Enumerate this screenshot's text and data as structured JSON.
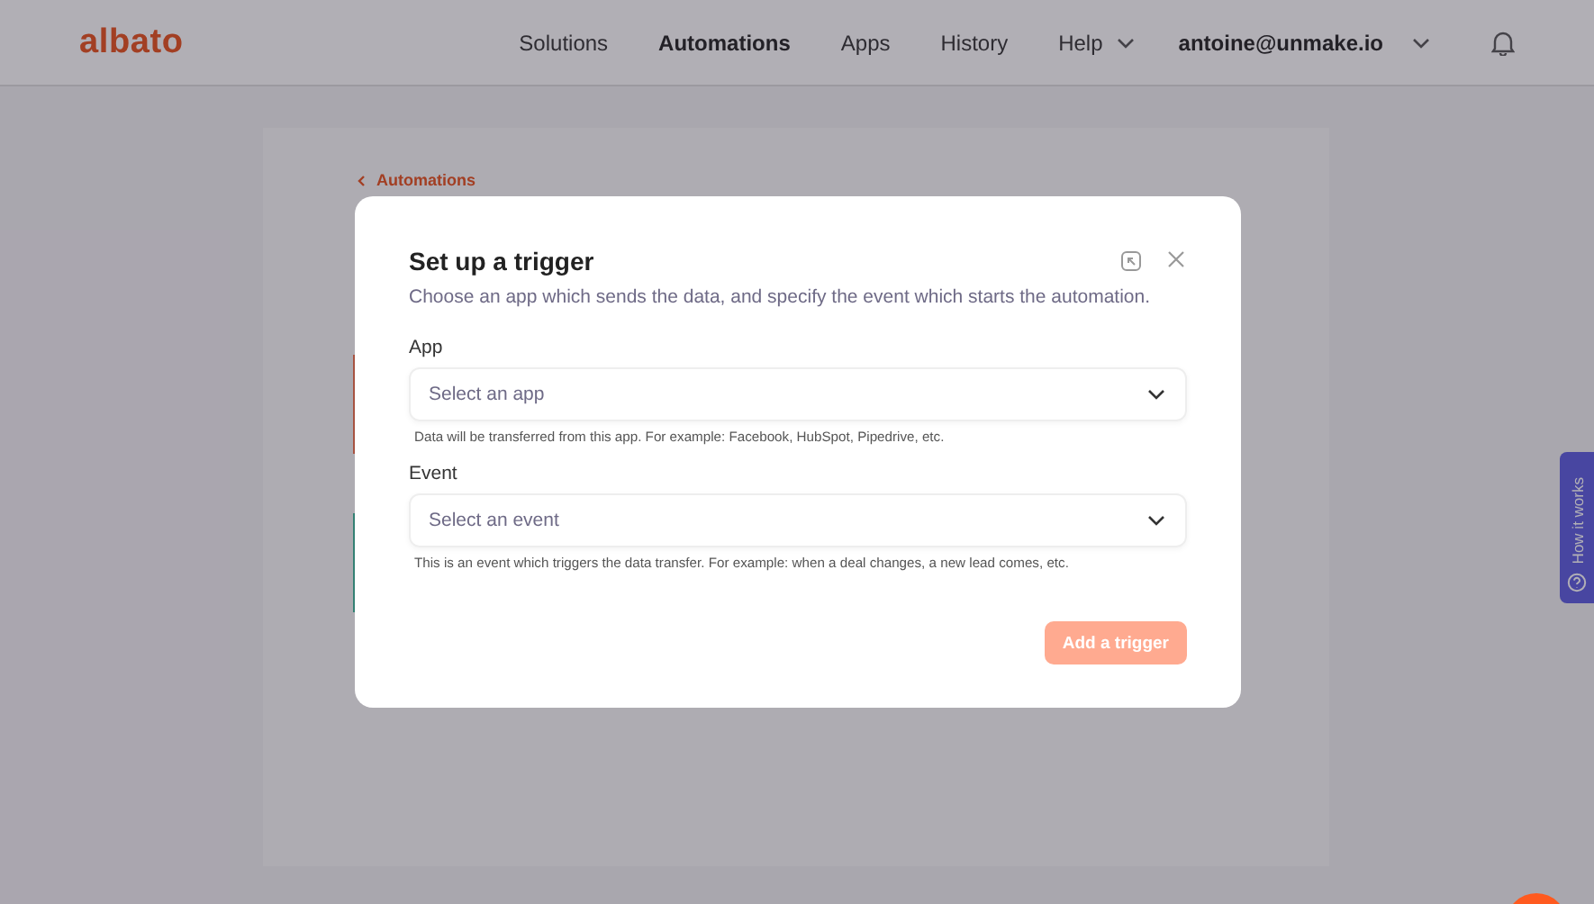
{
  "header": {
    "logo": "albato",
    "nav": [
      {
        "label": "Solutions",
        "selected": false,
        "kind": "link"
      },
      {
        "label": "Automations",
        "selected": true,
        "kind": "link"
      },
      {
        "label": "Apps",
        "selected": false,
        "kind": "link"
      },
      {
        "label": "History",
        "selected": false,
        "kind": "link"
      },
      {
        "label": "Help",
        "selected": false,
        "kind": "menu"
      }
    ],
    "account": "antoine@unmake.io"
  },
  "breadcrumb": "Automations",
  "modal": {
    "title": "Set up a trigger",
    "subtitle": "Choose an app which sends the data, and specify the event which starts the automation.",
    "fields": [
      {
        "label": "App",
        "placeholder": "Select an app",
        "hint": "Data will be transferred from this app. For example: Facebook, HubSpot, Pipedrive, etc."
      },
      {
        "label": "Event",
        "placeholder": "Select an event",
        "hint": "This is an event which triggers the data transfer. For example: when a deal changes, a new lead comes, etc."
      }
    ],
    "button": {
      "label": "Add a trigger",
      "disabled": true
    }
  },
  "help_tab": "How it works"
}
